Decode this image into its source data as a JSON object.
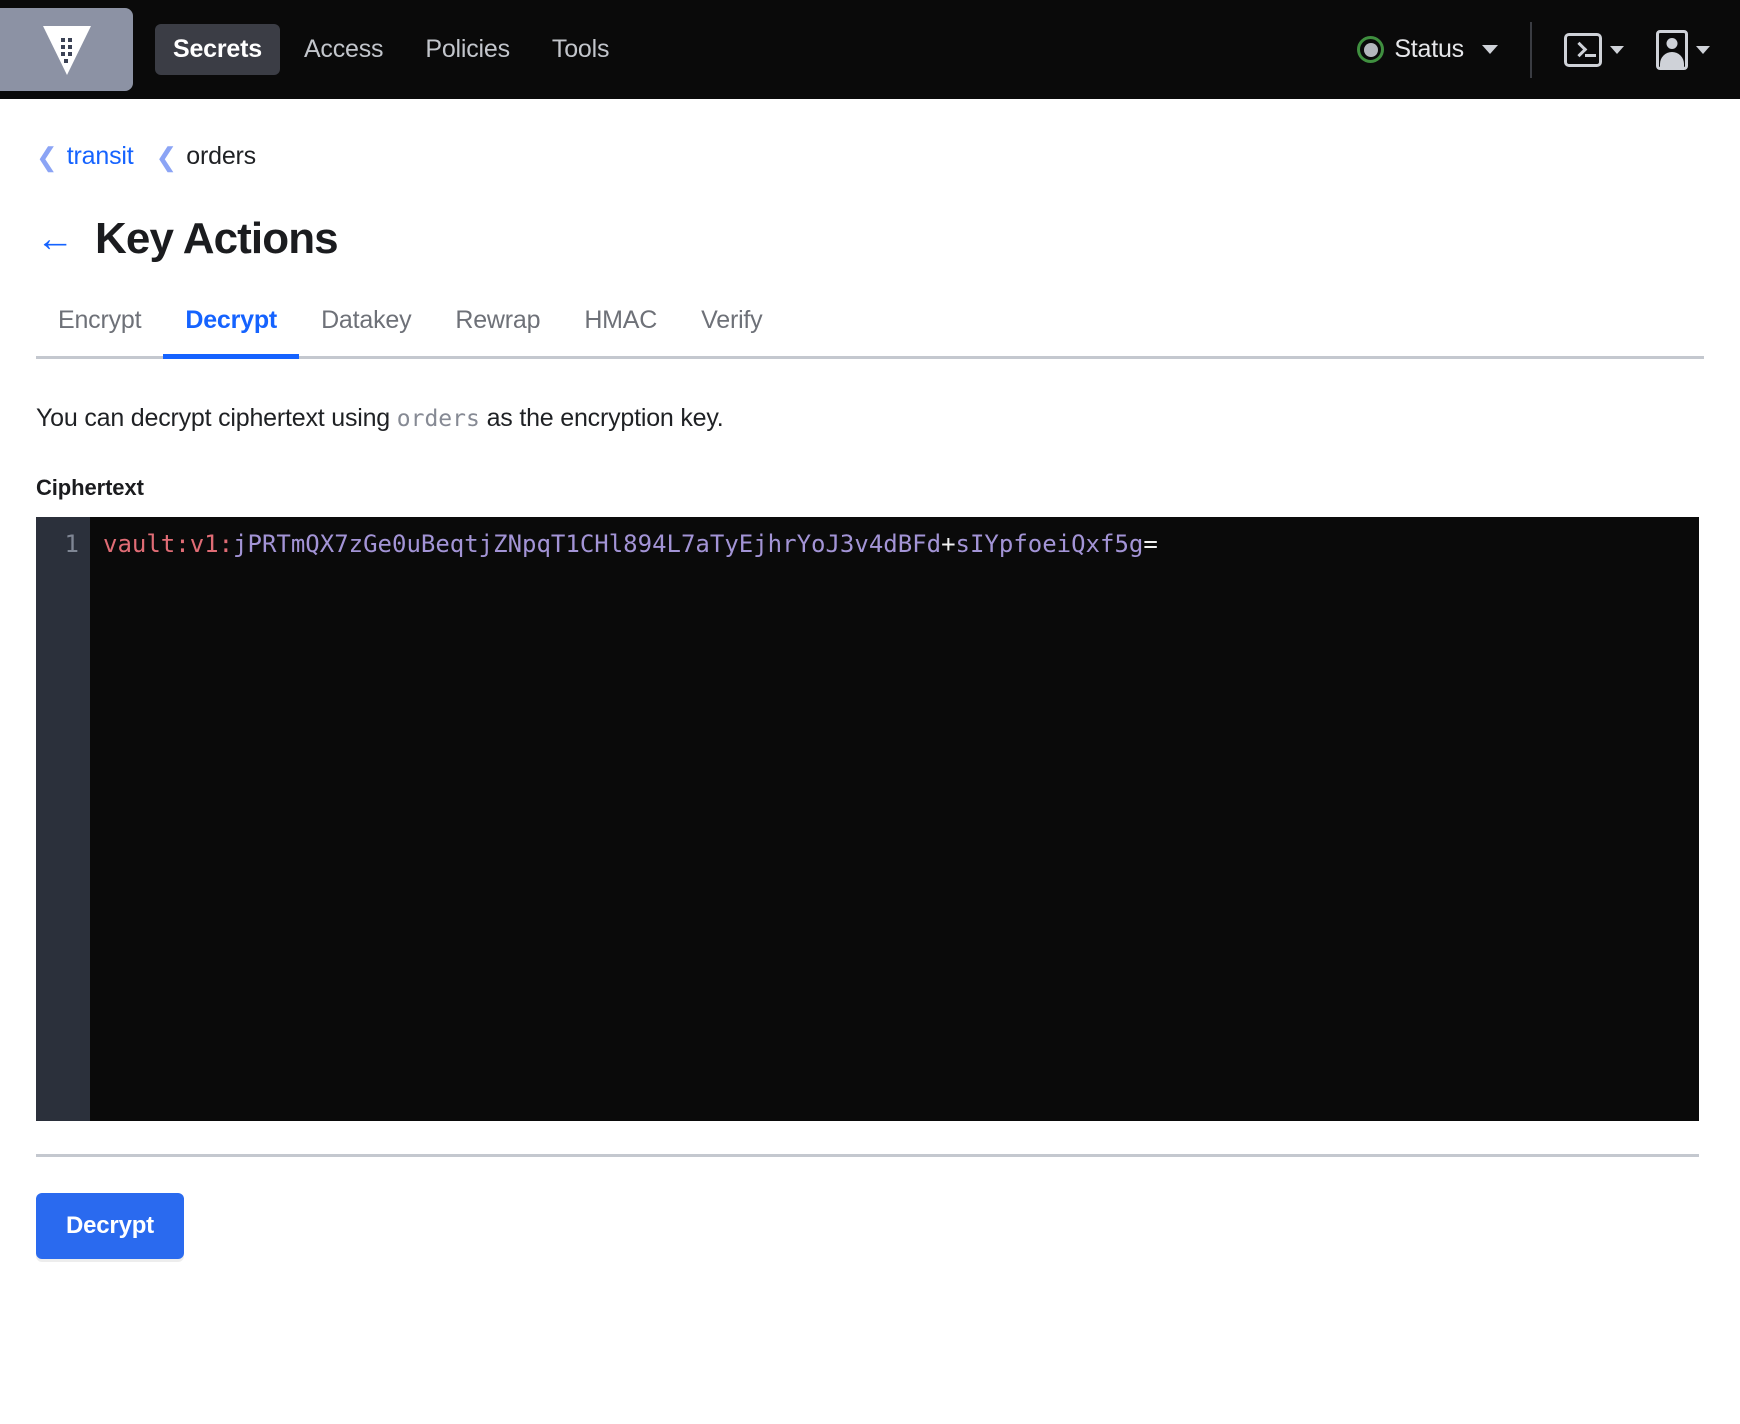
{
  "navbar": {
    "logo_name": "vault-logo",
    "links": [
      {
        "label": "Secrets",
        "active": true
      },
      {
        "label": "Access",
        "active": false
      },
      {
        "label": "Policies",
        "active": false
      },
      {
        "label": "Tools",
        "active": false
      }
    ],
    "status": {
      "label": "Status",
      "indicator_color": "#3f8f3f",
      "dot_color": "#b4b7bd"
    },
    "console_icon": "console-icon",
    "user_icon": "user-icon"
  },
  "breadcrumb": {
    "separator": "❮",
    "items": [
      {
        "label": "transit",
        "is_link": true
      },
      {
        "label": "orders",
        "is_link": false
      }
    ]
  },
  "header": {
    "back_arrow": "←",
    "title": "Key Actions"
  },
  "tabs": [
    {
      "label": "Encrypt",
      "active": false
    },
    {
      "label": "Decrypt",
      "active": true
    },
    {
      "label": "Datakey",
      "active": false
    },
    {
      "label": "Rewrap",
      "active": false
    },
    {
      "label": "HMAC",
      "active": false
    },
    {
      "label": "Verify",
      "active": false
    }
  ],
  "main": {
    "description_before": "You can decrypt ciphertext using ",
    "description_key": "orders",
    "description_after": " as the encryption key.",
    "ciphertext_label": "Ciphertext",
    "editor": {
      "line_number": "1",
      "value_prefix": "vault:v1:",
      "value_body": "jPRTmQX7zGe0uBeqtjZNpqT1CHl894L7aTyEjhrYoJ3v4dBFd",
      "value_plus": "+",
      "value_tail": "sIYpfoeiQxf5g",
      "value_equals": "=",
      "full_value": "vault:v1:jPRTmQX7zGe0uBeqtjZNpqT1CHl894L7aTyEjhrYoJ3v4dBFd+sIYpfoeiQxf5g="
    },
    "submit_label": "Decrypt"
  },
  "colors": {
    "accent": "#1563ff",
    "button": "#2a6aef",
    "navbar_bg": "#0a0a0a",
    "editor_bg": "#0a0a0a",
    "gutter_bg": "#2b303b",
    "logo_tile": "#8c92a4"
  }
}
